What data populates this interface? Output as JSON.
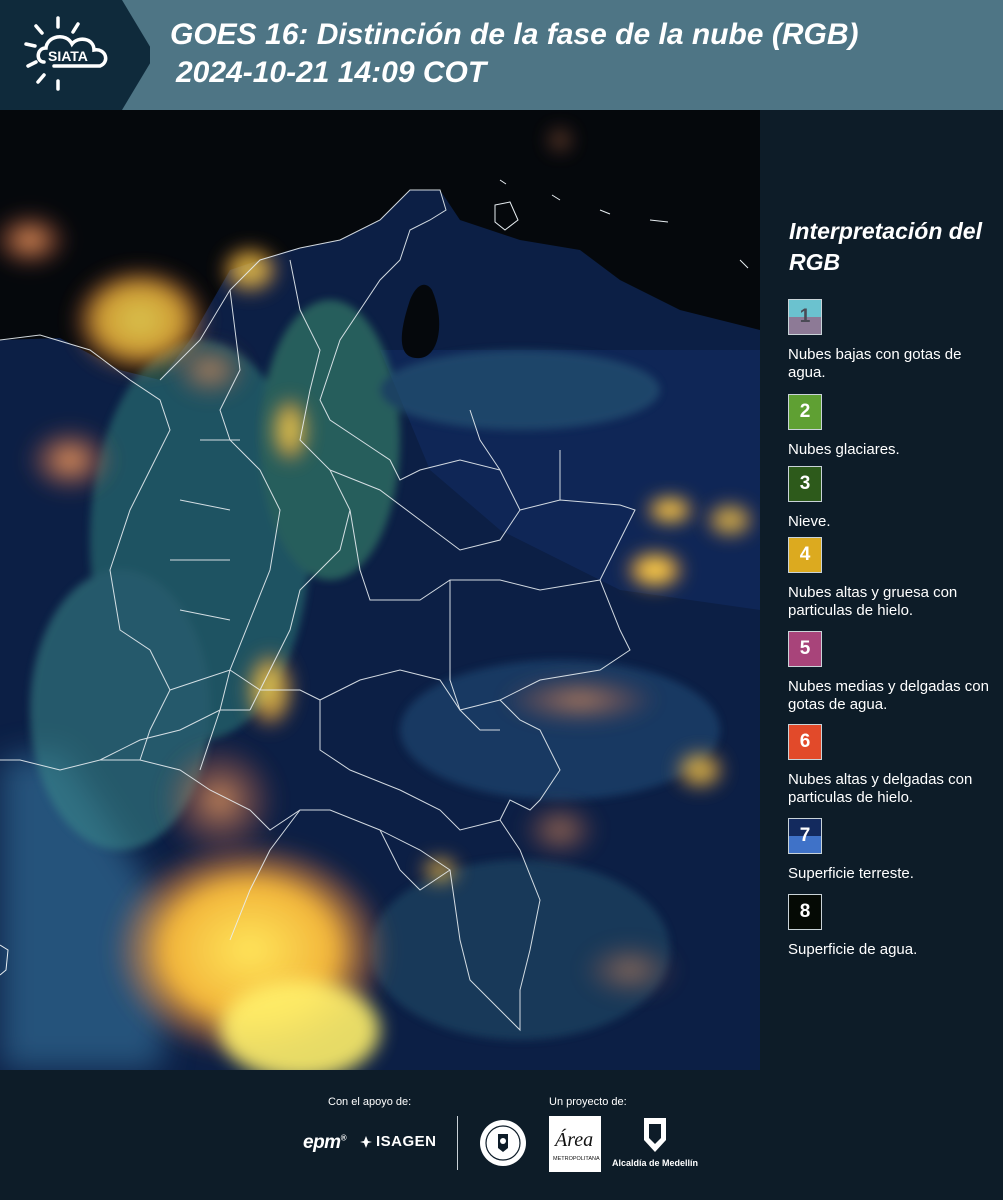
{
  "header": {
    "logo_text": "SIATA",
    "title_line1": "GOES 16: Distinción de la fase de la nube (RGB)",
    "title_line2": "2024-10-21 14:09 COT"
  },
  "legend": {
    "title": "Interpretación del RGB",
    "items": [
      {
        "number": "1",
        "label": "Nubes bajas con gotas de agua.",
        "color_top": "#6bc2cf",
        "color_bottom": "#8d7a96"
      },
      {
        "number": "2",
        "label": "Nubes glaciares.",
        "color": "#5fa033"
      },
      {
        "number": "3",
        "label": "Nieve.",
        "color": "#2d5a1b"
      },
      {
        "number": "4",
        "label": "Nubes altas y gruesa con particulas de hielo.",
        "color": "#dcaa1f"
      },
      {
        "number": "5",
        "label": "Nubes medias y delgadas con gotas de agua.",
        "color": "#a8447a"
      },
      {
        "number": "6",
        "label": "Nubes altas y delgadas con particulas de hielo.",
        "color": "#e24a2a"
      },
      {
        "number": "7",
        "label": "Superficie terreste.",
        "color_top": "#132a5e",
        "color_bottom": "#3f72c8"
      },
      {
        "number": "8",
        "label": "Superficie de agua.",
        "color": "#050a05"
      }
    ]
  },
  "footer": {
    "support_label": "Con el apoyo de:",
    "project_label": "Un proyecto de:",
    "epm": "epm",
    "isagen": "ISAGEN",
    "area_text": "Área",
    "area_subtext": "METROPOLITANA",
    "alcaldia": "Alcaldía de Medellín"
  }
}
